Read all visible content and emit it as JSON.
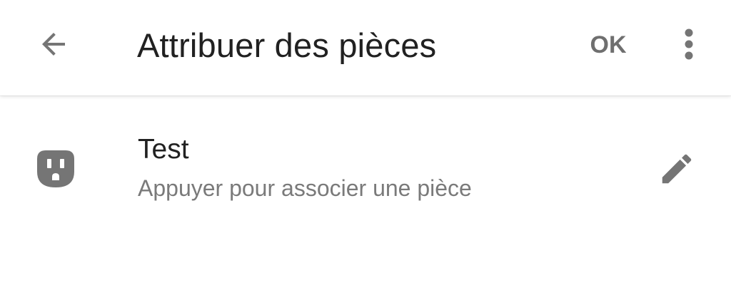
{
  "toolbar": {
    "back_icon": "arrow-left-icon",
    "title": "Attribuer des pièces",
    "ok_label": "OK",
    "more_icon": "more-vertical-icon"
  },
  "devices": [
    {
      "icon": "power-outlet-icon",
      "name": "Test",
      "subtitle": "Appuyer pour associer une pièce",
      "action_icon": "pencil-icon"
    }
  ],
  "colors": {
    "background": "#ffffff",
    "title_text": "#212121",
    "secondary_text": "#7a7a7a",
    "icon_gray": "#757575"
  }
}
